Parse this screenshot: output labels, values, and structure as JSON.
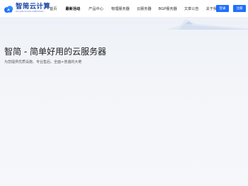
{
  "brand": {
    "name": "智简云计算",
    "tagline": "ZHI JIAN CLOUD COMPUTING"
  },
  "nav": {
    "items": [
      {
        "label": "首页",
        "active": false
      },
      {
        "label": "最新活动",
        "active": true
      },
      {
        "label": "产品中心",
        "active": false
      },
      {
        "label": "物理服务器",
        "active": false
      },
      {
        "label": "云服务器",
        "active": false
      },
      {
        "label": "BGP服务器",
        "active": false
      },
      {
        "label": "文章公告",
        "active": false
      },
      {
        "label": "关于我们",
        "active": false
      }
    ]
  },
  "auth": {
    "login_label": "登录",
    "register_label": "注册"
  },
  "hero": {
    "title": "智简 - 简单好用的云服务器",
    "subtitle": "为您提供优质设施、专业售后、全面+普遍的大佬"
  },
  "colors": {
    "primary": "#1f6fff",
    "brand": "#1f4aa8",
    "hero_bg": "#f2f4f8"
  }
}
